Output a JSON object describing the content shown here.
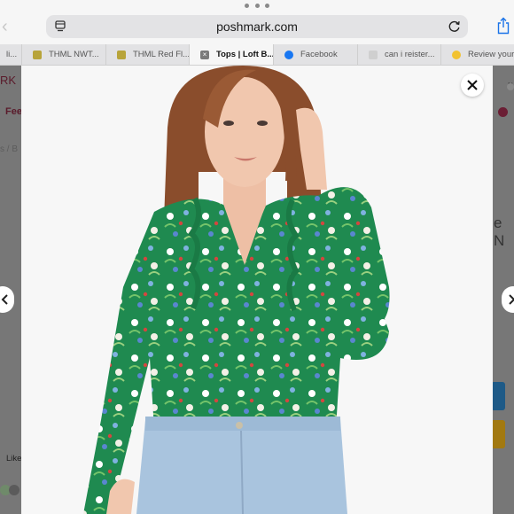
{
  "browser": {
    "url": "poshmark.com",
    "tabs": [
      {
        "label": "li...",
        "favicon_color": "#c9a14a",
        "active": false
      },
      {
        "label": "THML NWT...",
        "favicon_color": "#b8a43a",
        "active": false
      },
      {
        "label": "THML Red Fl...",
        "favicon_color": "#b8a43a",
        "active": false
      },
      {
        "label": "Tops | Loft B...",
        "favicon_color": "#7a7a7a",
        "active": true
      },
      {
        "label": "Facebook",
        "favicon_color": "#1877f2",
        "active": false
      },
      {
        "label": "can i reister...",
        "favicon_color": "#cfcfcf",
        "active": false
      },
      {
        "label": "Review your...",
        "favicon_color": "#f2c230",
        "active": false
      }
    ]
  },
  "background_page": {
    "logo_fragment": "RK",
    "feed_fragment": "Fee",
    "breadcrumb_fragment": "s / B",
    "like_fragment": "Like",
    "title_fragment": "e N",
    "right_label": "N"
  },
  "modal": {
    "close_label": "×",
    "prev_label": "‹",
    "next_label": "›",
    "image_description_colors": {
      "background": "#f7f7f7",
      "blouse": "#1f8a50",
      "jeans": "#a9c4de",
      "hair": "#8a4d2c",
      "skin": "#f1c7ae"
    }
  }
}
